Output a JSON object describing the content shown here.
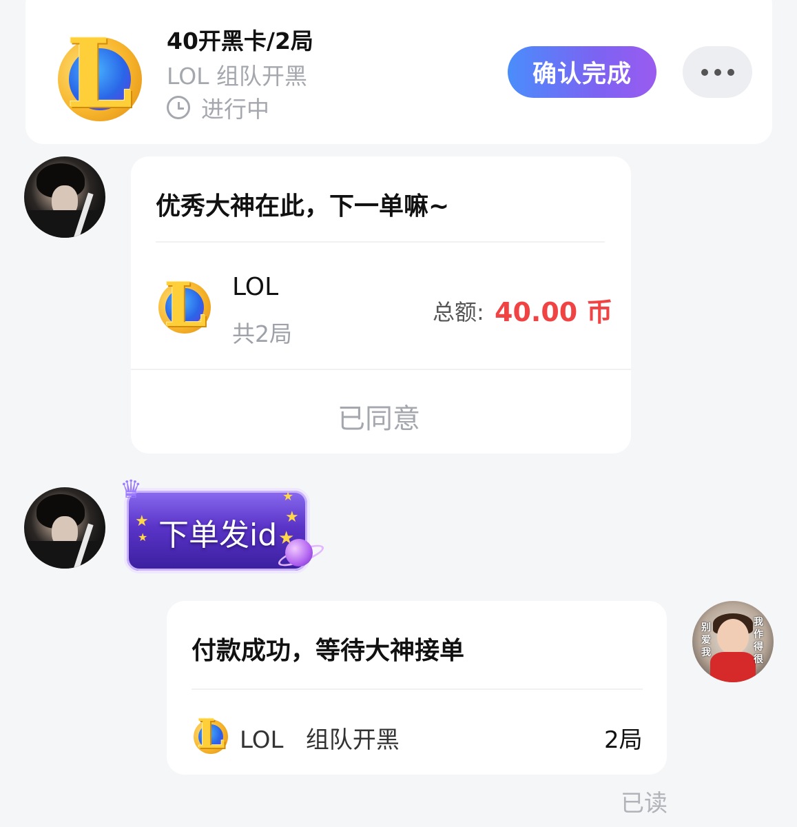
{
  "order": {
    "title": "40开黑卡/2局",
    "game_category": "LOL 组队开黑",
    "status": "进行中",
    "confirm_button": "确认完成",
    "more_icon": "more-dots-icon"
  },
  "messages": [
    {
      "sender": "god",
      "text": "优秀大神在此，下一单嘛~",
      "game": "LOL",
      "rounds": "共2局",
      "total_label": "总额:",
      "total_value": "40.00 币",
      "action": "已同意"
    },
    {
      "sender": "god",
      "sticker_text": "下单发id"
    },
    {
      "sender": "me",
      "text": "付款成功，等待大神接单",
      "game_line": "LOL   组队开黑",
      "rounds": "2局",
      "read_status": "已读"
    }
  ],
  "avatar_caption": {
    "left": "别爱我",
    "right": "我作得很"
  },
  "colors": {
    "accent_gradient_start": "#4a8dfb",
    "accent_gradient_end": "#9a5bf0",
    "price_red": "#f04444",
    "background": "#f5f6f8"
  }
}
